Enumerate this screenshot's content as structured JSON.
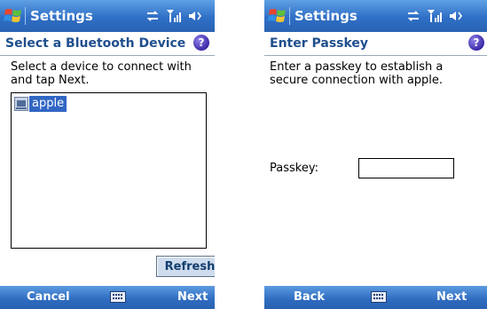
{
  "colors": {
    "titlebar": "#2f6fc6",
    "header_text": "#1f4f8e",
    "selection": "#3166c4"
  },
  "screens": [
    {
      "app_title": "Settings",
      "status_icons": [
        "connectivity-icon",
        "signal-icon",
        "speaker-icon"
      ],
      "header_title": "Select a Bluetooth Device",
      "help_icon": "?",
      "instruction": "Select a device to connect with and tap Next.",
      "devices": [
        {
          "name": "apple",
          "icon": "device-icon",
          "selected": true
        }
      ],
      "refresh_label": "Refresh",
      "softkeys": {
        "left": "Cancel",
        "right": "Next"
      }
    },
    {
      "app_title": "Settings",
      "status_icons": [
        "connectivity-icon",
        "signal-icon",
        "speaker-icon"
      ],
      "header_title": "Enter Passkey",
      "help_icon": "?",
      "instruction": "Enter a passkey to establish a secure connection with apple.",
      "passkey_label": "Passkey:",
      "passkey_value": "",
      "softkeys": {
        "left": "Back",
        "right": "Next"
      }
    }
  ]
}
